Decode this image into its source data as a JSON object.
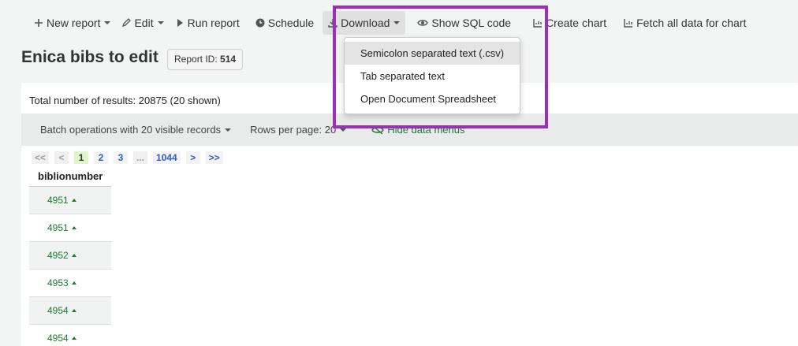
{
  "toolbar": {
    "new_report": "New report",
    "edit": "Edit",
    "run_report": "Run report",
    "schedule": "Schedule",
    "download": "Download",
    "show_sql": "Show SQL code",
    "create_chart": "Create chart",
    "fetch_all": "Fetch all data for chart"
  },
  "download_menu": {
    "items": [
      "Semicolon separated text (.csv)",
      "Tab separated text",
      "Open Document Spreadsheet"
    ]
  },
  "report": {
    "title": "Enica bibs to edit",
    "id_label": "Report ID:",
    "id_value": "514"
  },
  "results": {
    "total_label": "Total number of results:",
    "total_value": "20875 (20 shown)"
  },
  "batchbar": {
    "batch": "Batch operations with 20 visible records",
    "rows_per_page": "Rows per page: 20",
    "hide_menus": "Hide data menus"
  },
  "pager": {
    "first": "<<",
    "prev": "<",
    "pages": [
      "1",
      "2",
      "3"
    ],
    "ellipsis": "...",
    "last_page": "1044",
    "next": ">",
    "last": ">>"
  },
  "table": {
    "header": "biblionumber",
    "rows": [
      "4951",
      "4951",
      "4952",
      "4953",
      "4954",
      "4954"
    ]
  },
  "colors": {
    "highlight": "#9b30b8",
    "link_green": "#1a7a2e",
    "link_blue": "#2f5fbf"
  }
}
